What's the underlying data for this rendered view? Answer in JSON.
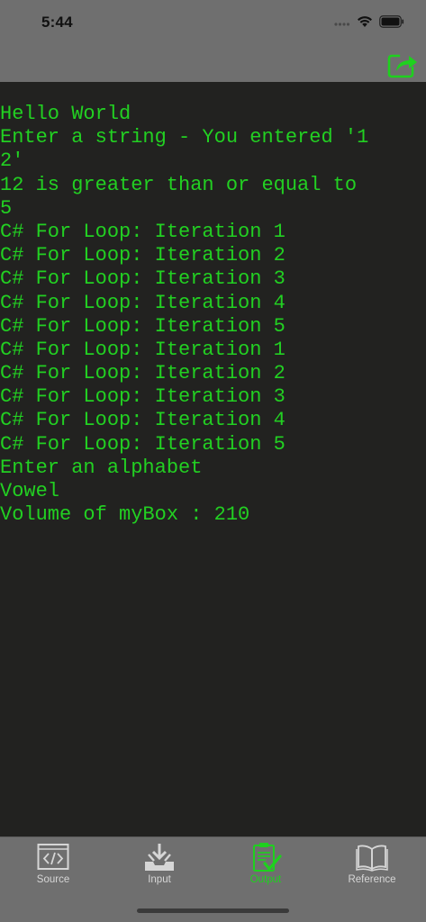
{
  "status_bar": {
    "time": "5:44"
  },
  "console": {
    "lines": [
      "Hello World",
      "Enter a string - You entered '1",
      "2'",
      "12 is greater than or equal to",
      "5",
      "C# For Loop: Iteration 1",
      "C# For Loop: Iteration 2",
      "C# For Loop: Iteration 3",
      "C# For Loop: Iteration 4",
      "C# For Loop: Iteration 5",
      "C# For Loop: Iteration 1",
      "C# For Loop: Iteration 2",
      "C# For Loop: Iteration 3",
      "C# For Loop: Iteration 4",
      "C# For Loop: Iteration 5",
      "Enter an alphabet",
      "Vowel",
      "Volume of myBox : 210"
    ]
  },
  "tabs": [
    {
      "label": "Source",
      "icon": "code-icon",
      "active": false
    },
    {
      "label": "Input",
      "icon": "input-tray-icon",
      "active": false
    },
    {
      "label": "Output",
      "icon": "clipboard-check-icon",
      "active": true
    },
    {
      "label": "Reference",
      "icon": "book-icon",
      "active": false
    }
  ],
  "colors": {
    "console_text": "#22d022",
    "console_bg": "#222220",
    "bar_bg": "#6f6f6f",
    "accent": "#1ed11e"
  }
}
